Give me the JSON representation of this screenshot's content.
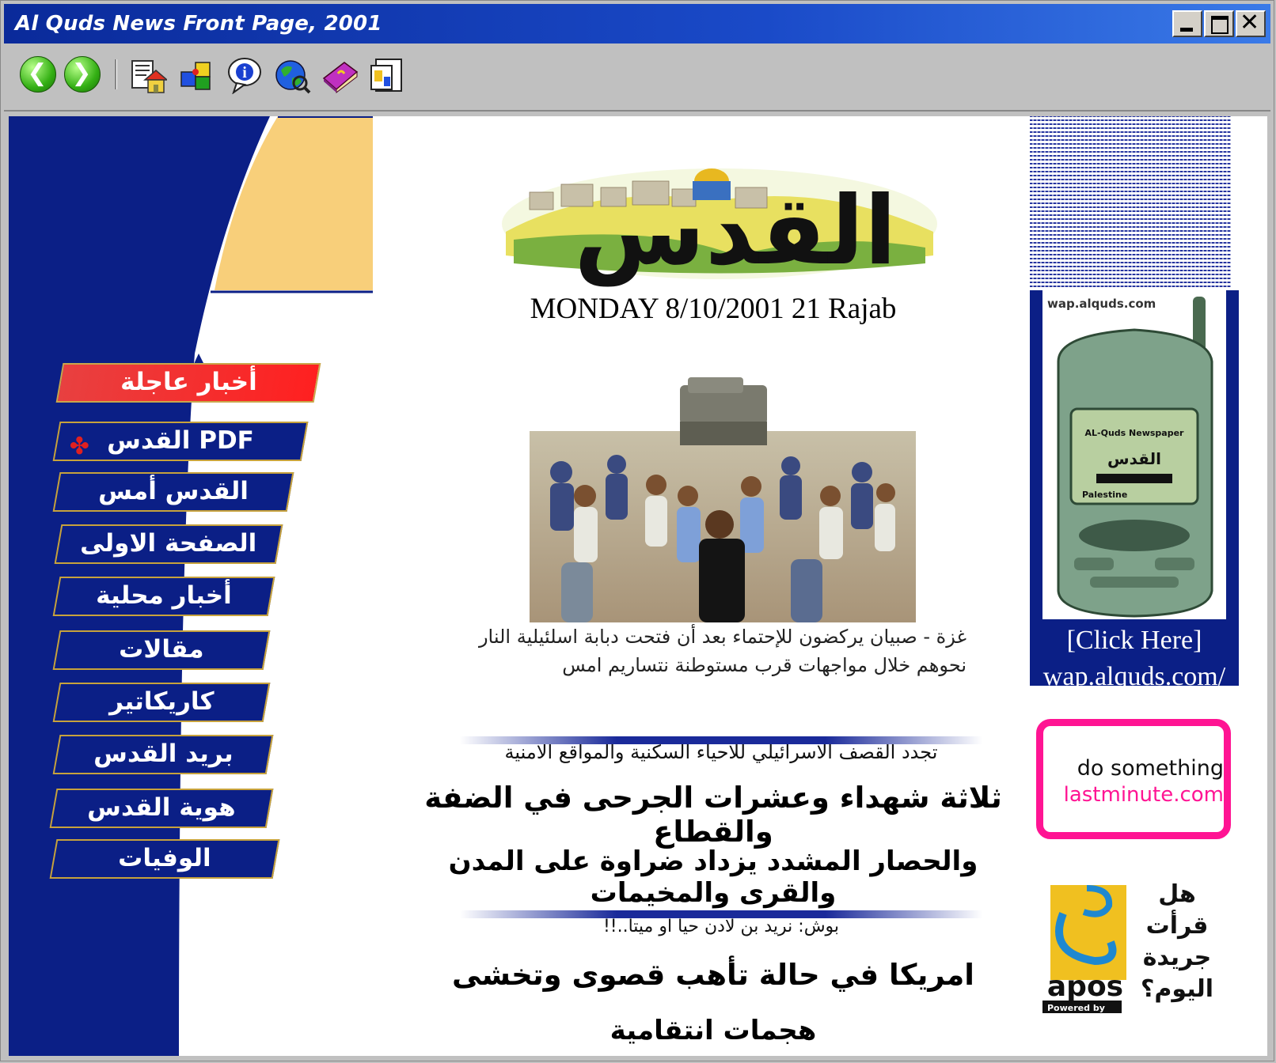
{
  "window": {
    "title": "Al Quds News Front Page, 2001"
  },
  "toolbar": {
    "icons": [
      "back-icon",
      "forward-icon",
      "home-icon",
      "puzzle-icon",
      "info-icon",
      "globe-icon",
      "book-icon",
      "bookmark-icon"
    ]
  },
  "left_nav": {
    "items": [
      {
        "label": "أخبار عاجلة"
      },
      {
        "label": "القدس PDF"
      },
      {
        "label": "القدس أمس"
      },
      {
        "label": "الصفحة الاولى"
      },
      {
        "label": "أخبار محلية"
      },
      {
        "label": "مقالات"
      },
      {
        "label": "كاريكاتير"
      },
      {
        "label": "بريد القدس"
      },
      {
        "label": "هوية القدس"
      },
      {
        "label": "الوفيات"
      }
    ]
  },
  "main": {
    "logo_text": "القدس",
    "date": "MONDAY 8/10/2001 21 Rajab",
    "caption": "غزة - صبيان يركضون للإحتماء بعد أن فتحت دبابة اسلئيلية النار نحوهم خلال مواجهات قرب مستوطنة نتساريم امس",
    "story1_sub": "تجدد القصف الاسرائيلي للاحياء السكنية والمواقع الامنية",
    "story1_head1": "ثلاثة شهداء وعشرات الجرحى في الضفة والقطاع",
    "story1_head2": "والحصار المشدد يزداد ضراوة على المدن والقرى والمخيمات",
    "story2_sub": "بوش: نريد بن لادن حيا او ميتا..!!",
    "story2_head1": "امريكا في حالة تأهب قصوى وتخشى",
    "story2_head2": "هجمات انتقامية"
  },
  "right": {
    "wap_domain": "wap.alquds.com",
    "phone_line1": "AL-Quds Newspaper",
    "phone_line2": "Palestine",
    "click_here": "[Click Here]",
    "wap_url": "wap.alquds.com/",
    "ad1_line1": "do something",
    "ad1_line2": "lastminute.com",
    "ad2_text": "هل قرأت جريدة اليوم؟",
    "ad2_brand": "apos",
    "ad2_powered": "Powered by"
  },
  "colors": {
    "navy": "#0b1f86",
    "gold": "#c7a23c",
    "red": "#ff2020",
    "pink": "#ff1493"
  }
}
